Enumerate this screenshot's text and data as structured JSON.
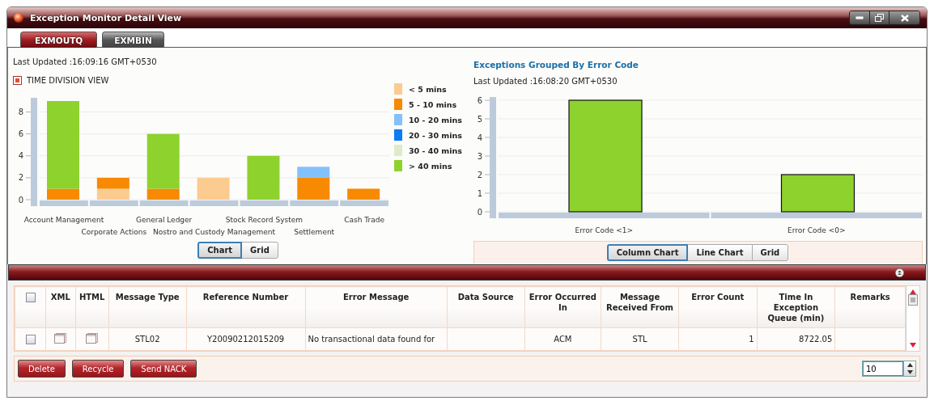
{
  "window": {
    "title": "Exception Monitor Detail View"
  },
  "tabs": [
    {
      "label": "EXMOUTQ",
      "selected": true
    },
    {
      "label": "EXMBIN",
      "selected": false
    }
  ],
  "time_division": {
    "last_updated": "Last Updated :16:09:16 GMT+0530",
    "view_toggle": {
      "label": "TIME DIVISION VIEW",
      "checked": true
    },
    "chart_data": {
      "type": "bar",
      "stacked": true,
      "grid": true,
      "categories": [
        "Account Management",
        "Corporate Actions",
        "General Ledger",
        "Nostro and Custody Management",
        "Stock Record System",
        "Settlement",
        "Cash Trade"
      ],
      "ylim": [
        0,
        9
      ],
      "yticks": [
        0,
        2,
        4,
        6,
        8
      ],
      "series": [
        {
          "name": "< 5 mins",
          "color": "#fccb8f",
          "values": [
            0,
            1,
            0,
            2,
            0,
            0,
            0
          ]
        },
        {
          "name": "5 - 10 mins",
          "color": "#f78a00",
          "values": [
            1,
            1,
            1,
            0,
            0,
            2,
            1
          ]
        },
        {
          "name": "10 - 20 mins",
          "color": "#84c1fb",
          "values": [
            0,
            0,
            0,
            0,
            0,
            1,
            0
          ]
        },
        {
          "name": "20 - 30 mins",
          "color": "#0a7df0",
          "values": [
            0,
            0,
            0,
            0,
            0,
            0,
            0
          ]
        },
        {
          "name": "30 - 40 mins",
          "color": "#dcecc8",
          "values": [
            0,
            0,
            0,
            0,
            0,
            0,
            0
          ]
        },
        {
          "name": "> 40 mins",
          "color": "#8ed22e",
          "values": [
            8,
            0,
            5,
            0,
            4,
            0,
            0
          ]
        }
      ]
    },
    "view_buttons": [
      {
        "label": "Chart",
        "selected": true
      },
      {
        "label": "Grid",
        "selected": false
      }
    ]
  },
  "error_code": {
    "title": "Exceptions Grouped By Error Code",
    "last_updated": "Last Updated :16:08:20 GMT+0530",
    "chart_data": {
      "type": "bar",
      "grid": true,
      "categories": [
        "Error Code <1>",
        "Error Code <0>"
      ],
      "values": [
        6,
        2
      ],
      "ylim": [
        0,
        6
      ],
      "yticks": [
        0,
        1,
        2,
        3,
        4,
        5,
        6
      ]
    },
    "view_buttons": [
      {
        "label": "Column Chart",
        "selected": true
      },
      {
        "label": "Line Chart",
        "selected": false
      },
      {
        "label": "Grid",
        "selected": false
      }
    ]
  },
  "table": {
    "select_all": {
      "checked": false
    },
    "columns": [
      "XML",
      "HTML",
      "Message Type",
      "Reference Number",
      "Error Message",
      "Data Source",
      "Error Occurred In",
      "Message Received From",
      "Error Count",
      "Time In Exception Queue (min)",
      "Remarks"
    ],
    "rows": [
      {
        "checked": false,
        "message_type": "STL02",
        "reference_number": "Y20090212015209",
        "error_message": "No transactional data found for",
        "error_occurred_in": "ACM",
        "message_received_from": "STL",
        "error_count": "1",
        "time_in_queue": "8722.05"
      }
    ]
  },
  "actions": [
    "Delete",
    "Recycle",
    "Send NACK"
  ],
  "page_size": "10"
}
